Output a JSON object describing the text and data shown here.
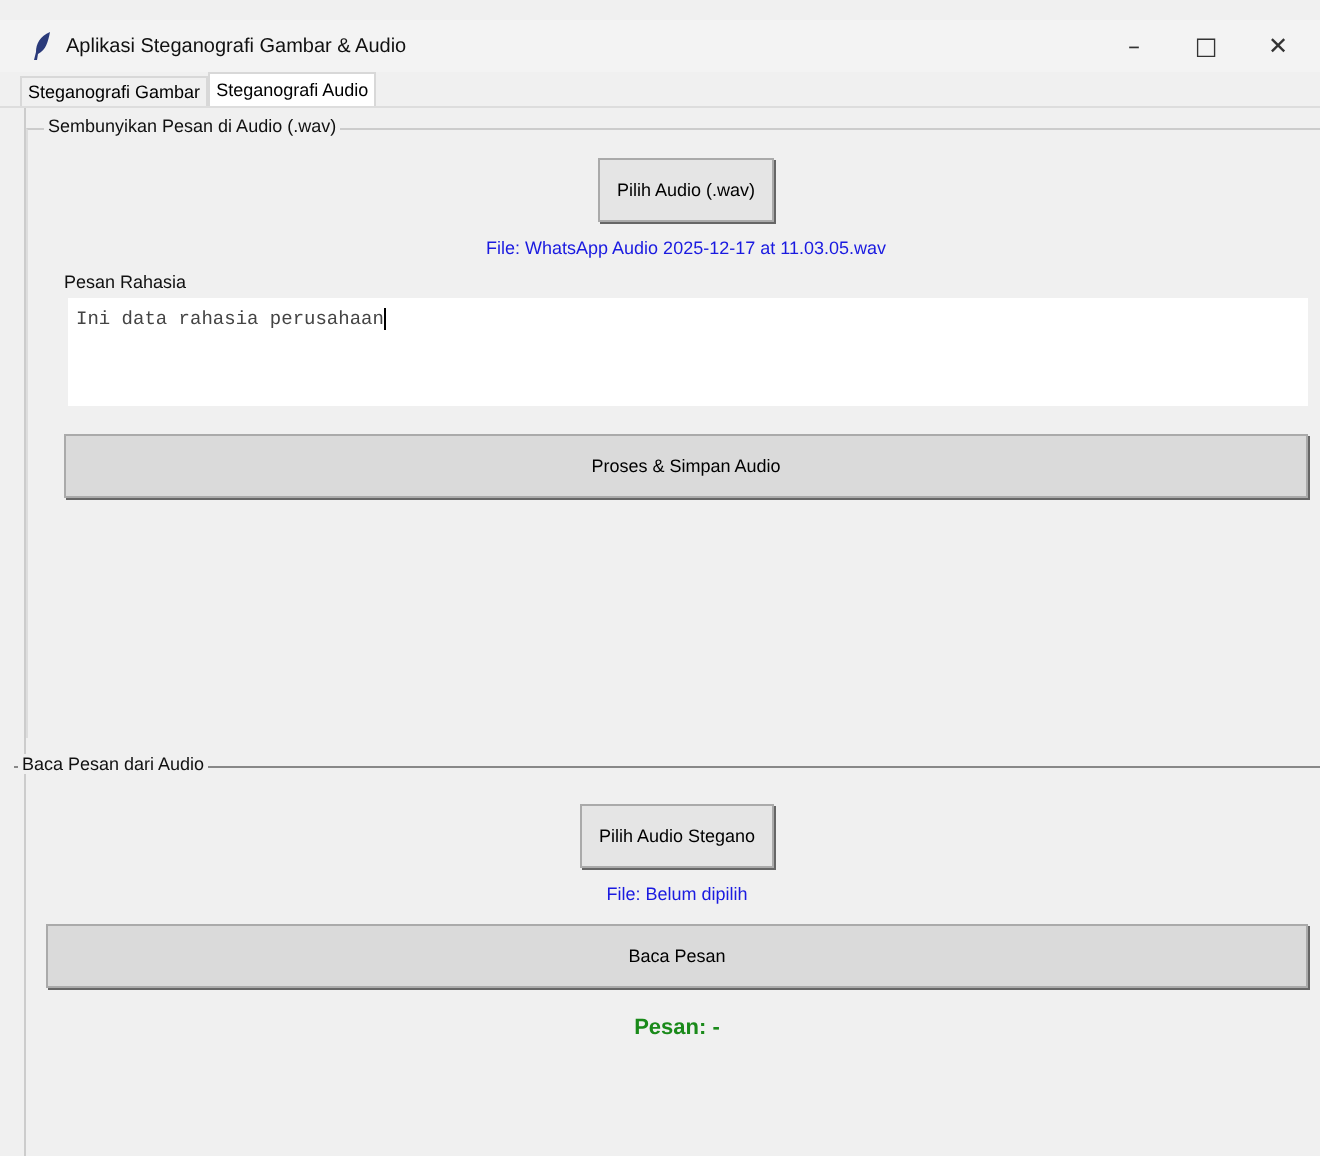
{
  "window": {
    "title": "Aplikasi Steganografi Gambar & Audio",
    "controls": [
      "–",
      "□",
      "✕"
    ]
  },
  "tabs": [
    {
      "label": "Steganografi Gambar",
      "selected": false
    },
    {
      "label": "Steganografi Audio",
      "selected": true
    }
  ],
  "hide_section": {
    "title": "Sembunyikan Pesan di Audio (.wav)",
    "choose_button": "Pilih Audio (.wav)",
    "file_label": "File: WhatsApp Audio 2025-12-17 at 11.03.05.wav",
    "message_label": "Pesan Rahasia",
    "message_value": "Ini data rahasia perusahaan",
    "process_button": "Proses & Simpan Audio"
  },
  "read_section": {
    "title": "Baca Pesan dari Audio",
    "choose_button": "Pilih Audio Stegano",
    "file_label": "File: Belum dipilih",
    "read_button": "Baca Pesan",
    "result": "Pesan: -"
  }
}
